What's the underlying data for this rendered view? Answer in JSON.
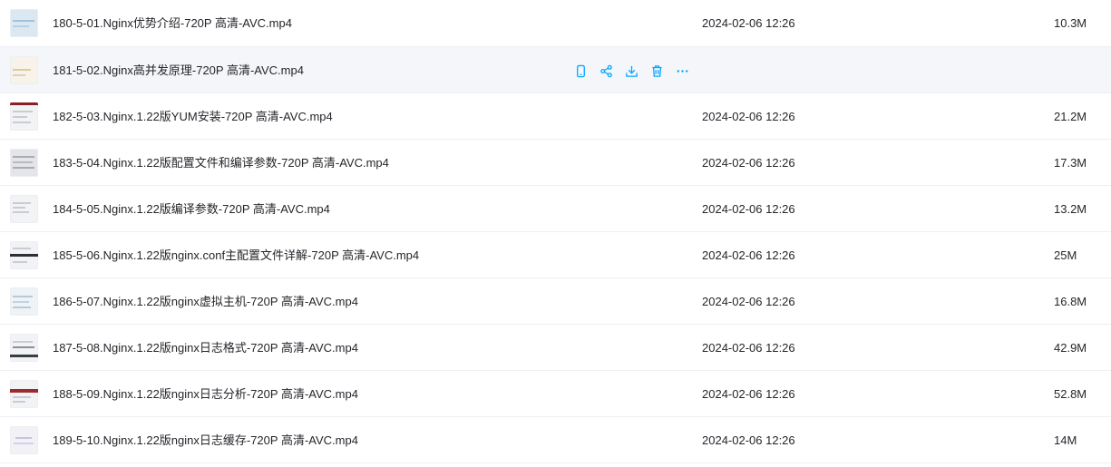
{
  "colors": {
    "accent": "#06a7ff",
    "text": "#25262b",
    "divider": "#eef0f4",
    "hover_bg": "#f5f6fa"
  },
  "file_list": [
    {
      "name": "180-5-01.Nginx优势介绍-720P 高清-AVC.mp4",
      "modified": "2024-02-06 12:26",
      "size": "10.3M",
      "hovered": false
    },
    {
      "name": "181-5-02.Nginx高并发原理-720P 高清-AVC.mp4",
      "modified": "",
      "size": "",
      "hovered": true,
      "actions": [
        "phone-icon",
        "share-icon",
        "download-icon",
        "delete-icon",
        "more-icon"
      ]
    },
    {
      "name": "182-5-03.Nginx.1.22版YUM安装-720P 高清-AVC.mp4",
      "modified": "2024-02-06 12:26",
      "size": "21.2M",
      "hovered": false
    },
    {
      "name": "183-5-04.Nginx.1.22版配置文件和编译参数-720P 高清-AVC.mp4",
      "modified": "2024-02-06 12:26",
      "size": "17.3M",
      "hovered": false
    },
    {
      "name": "184-5-05.Nginx.1.22版编译参数-720P 高清-AVC.mp4",
      "modified": "2024-02-06 12:26",
      "size": "13.2M",
      "hovered": false
    },
    {
      "name": "185-5-06.Nginx.1.22版nginx.conf主配置文件详解-720P 高清-AVC.mp4",
      "modified": "2024-02-06 12:26",
      "size": "25M",
      "hovered": false
    },
    {
      "name": "186-5-07.Nginx.1.22版nginx虚拟主机-720P 高清-AVC.mp4",
      "modified": "2024-02-06 12:26",
      "size": "16.8M",
      "hovered": false
    },
    {
      "name": "187-5-08.Nginx.1.22版nginx日志格式-720P 高清-AVC.mp4",
      "modified": "2024-02-06 12:26",
      "size": "42.9M",
      "hovered": false
    },
    {
      "name": "188-5-09.Nginx.1.22版nginx日志分析-720P 高清-AVC.mp4",
      "modified": "2024-02-06 12:26",
      "size": "52.8M",
      "hovered": false
    },
    {
      "name": "189-5-10.Nginx.1.22版nginx日志缓存-720P 高清-AVC.mp4",
      "modified": "2024-02-06 12:26",
      "size": "14M",
      "hovered": false
    }
  ]
}
